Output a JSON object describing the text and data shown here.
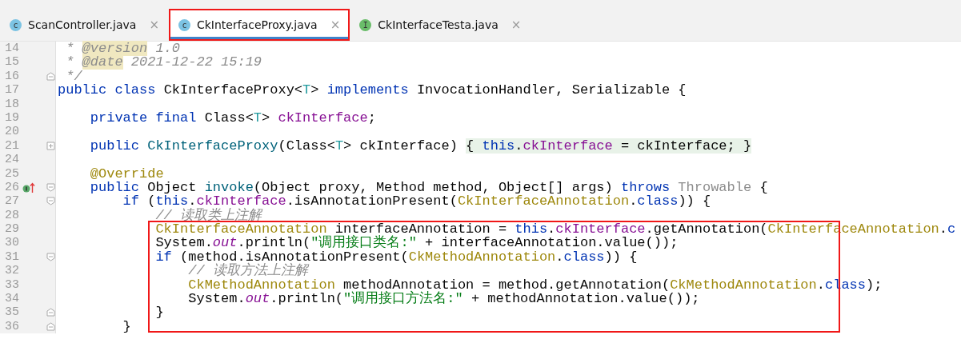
{
  "tabs": [
    {
      "label": "ScanController.java",
      "kind": "class",
      "icon_letter": "c",
      "close": "×",
      "selected": false,
      "boxed": false
    },
    {
      "label": "CkInterfaceProxy.java",
      "kind": "class",
      "icon_letter": "c",
      "close": "×",
      "selected": true,
      "boxed": true
    },
    {
      "label": "CkInterfaceTesta.java",
      "kind": "interface",
      "icon_letter": "I",
      "close": "×",
      "selected": false,
      "boxed": false
    }
  ],
  "lines": [
    {
      "number": "14",
      "tokens": [
        {
          "kind": "cmt",
          "text": " * "
        },
        {
          "kind": "doctag",
          "text": "@version"
        },
        {
          "kind": "cmt",
          "text": " 1.0"
        }
      ]
    },
    {
      "number": "15",
      "tokens": [
        {
          "kind": "cmt",
          "text": " * "
        },
        {
          "kind": "doctag",
          "text": "@date"
        },
        {
          "kind": "cmt",
          "text": " 2021-12-22 15:19"
        }
      ]
    },
    {
      "number": "16",
      "fold": {
        "kind": "end"
      },
      "tokens": [
        {
          "kind": "cmt",
          "text": " */"
        }
      ]
    },
    {
      "number": "17",
      "tokens": [
        {
          "kind": "kw",
          "text": "public class "
        },
        {
          "kind": "txt",
          "text": "CkInterfaceProxy<"
        },
        {
          "kind": "tp",
          "text": "T"
        },
        {
          "kind": "txt",
          "text": "> "
        },
        {
          "kind": "kw",
          "text": "implements "
        },
        {
          "kind": "txt",
          "text": "InvocationHandler, Serializable {"
        }
      ]
    },
    {
      "number": "18"
    },
    {
      "number": "19",
      "tokens": [
        {
          "kind": "kw",
          "text": "    private final "
        },
        {
          "kind": "txt",
          "text": "Class<"
        },
        {
          "kind": "tp",
          "text": "T"
        },
        {
          "kind": "txt",
          "text": "> "
        },
        {
          "kind": "fld",
          "text": "ckInterface"
        },
        {
          "kind": "txt",
          "text": ";"
        }
      ]
    },
    {
      "number": "20"
    },
    {
      "number": "21",
      "fold": {
        "kind": "collapsed"
      },
      "tokens": [
        {
          "kind": "kw",
          "text": "    public "
        },
        {
          "kind": "fn",
          "text": "CkInterfaceProxy"
        },
        {
          "kind": "txt",
          "text": "(Class<"
        },
        {
          "kind": "tp",
          "text": "T"
        },
        {
          "kind": "txt",
          "text": "> ckInterface) "
        },
        {
          "kind": "fold_txt",
          "text": "{ "
        },
        {
          "kind": "fold_kw",
          "text": "this"
        },
        {
          "kind": "fold_txt",
          "text": "."
        },
        {
          "kind": "fold_fld",
          "text": "ckInterface"
        },
        {
          "kind": "fold_txt",
          "text": " = ckInterface; }"
        }
      ]
    },
    {
      "number": "24"
    },
    {
      "number": "25",
      "tokens": [
        {
          "kind": "ann",
          "text": "    @Override"
        }
      ]
    },
    {
      "number": "26",
      "fold": {
        "kind": "start"
      },
      "marker": {
        "kind": "implements"
      },
      "tokens": [
        {
          "kind": "kw",
          "text": "    public "
        },
        {
          "kind": "txt",
          "text": "Object "
        },
        {
          "kind": "fn",
          "text": "invoke"
        },
        {
          "kind": "txt",
          "text": "(Object proxy, Method method, Object[] args) "
        },
        {
          "kind": "kw",
          "text": "throws "
        },
        {
          "kind": "unused",
          "text": "Throwable"
        },
        {
          "kind": "txt",
          "text": " {"
        }
      ]
    },
    {
      "number": "27",
      "fold": {
        "kind": "start"
      },
      "tokens": [
        {
          "kind": "kw",
          "text": "        if "
        },
        {
          "kind": "txt",
          "text": "("
        },
        {
          "kind": "kw",
          "text": "this"
        },
        {
          "kind": "txt",
          "text": "."
        },
        {
          "kind": "fld",
          "text": "ckInterface"
        },
        {
          "kind": "txt",
          "text": ".isAnnotationPresent("
        },
        {
          "kind": "ann",
          "text": "CkInterfaceAnnotation"
        },
        {
          "kind": "txt",
          "text": "."
        },
        {
          "kind": "kw",
          "text": "class"
        },
        {
          "kind": "txt",
          "text": ")) {"
        }
      ]
    },
    {
      "number": "28",
      "tokens": [
        {
          "kind": "cmt",
          "text": "            // 读取类上注解"
        }
      ]
    },
    {
      "kind": "highlight",
      "children": [
        {
          "number": "29",
          "tokens": [
            {
              "kind": "ann",
              "text": "            CkInterfaceAnnotation"
            },
            {
              "kind": "txt",
              "text": " interfaceAnnotation = "
            },
            {
              "kind": "kw",
              "text": "this"
            },
            {
              "kind": "txt",
              "text": "."
            },
            {
              "kind": "fld",
              "text": "ckInterface"
            },
            {
              "kind": "txt",
              "text": ".getAnnotation("
            },
            {
              "kind": "ann",
              "text": "CkInterfaceAnnotation"
            },
            {
              "kind": "txt",
              "text": "."
            },
            {
              "kind": "kw",
              "text": "c"
            }
          ]
        },
        {
          "number": "30",
          "tokens": [
            {
              "kind": "txt",
              "text": "            System."
            },
            {
              "kind": "sfld",
              "text": "out"
            },
            {
              "kind": "txt",
              "text": ".println("
            },
            {
              "kind": "str",
              "text": "\"调用接口类名:\""
            },
            {
              "kind": "txt",
              "text": " + interfaceAnnotation.value());"
            }
          ]
        },
        {
          "number": "31",
          "fold": {
            "kind": "start"
          },
          "tokens": [
            {
              "kind": "kw",
              "text": "            if "
            },
            {
              "kind": "txt",
              "text": "(method.isAnnotationPresent("
            },
            {
              "kind": "ann",
              "text": "CkMethodAnnotation"
            },
            {
              "kind": "txt",
              "text": "."
            },
            {
              "kind": "kw",
              "text": "class"
            },
            {
              "kind": "txt",
              "text": ")) {"
            }
          ]
        },
        {
          "number": "32",
          "tokens": [
            {
              "kind": "cmt",
              "text": "                // 读取方法上注解"
            }
          ]
        },
        {
          "number": "33",
          "tokens": [
            {
              "kind": "ann",
              "text": "                CkMethodAnnotation"
            },
            {
              "kind": "txt",
              "text": " methodAnnotation = method.getAnnotation("
            },
            {
              "kind": "ann",
              "text": "CkMethodAnnotation"
            },
            {
              "kind": "txt",
              "text": "."
            },
            {
              "kind": "kw",
              "text": "class"
            },
            {
              "kind": "txt",
              "text": ");"
            }
          ]
        },
        {
          "number": "34",
          "tokens": [
            {
              "kind": "txt",
              "text": "                System."
            },
            {
              "kind": "sfld",
              "text": "out"
            },
            {
              "kind": "txt",
              "text": ".println("
            },
            {
              "kind": "str",
              "text": "\"调用接口方法名:\""
            },
            {
              "kind": "txt",
              "text": " + methodAnnotation.value());"
            }
          ]
        },
        {
          "number": "35",
          "fold": {
            "kind": "end"
          },
          "tokens": [
            {
              "kind": "txt",
              "text": "            }"
            }
          ]
        }
      ]
    },
    {
      "number": "36",
      "fold": {
        "kind": "end"
      },
      "tokens": [
        {
          "kind": "txt",
          "text": "        }"
        }
      ]
    }
  ]
}
